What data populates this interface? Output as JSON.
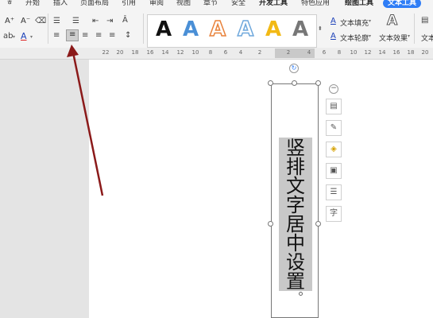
{
  "tabs": [
    {
      "label": "ㅎ"
    },
    {
      "label": "开始"
    },
    {
      "label": "插入"
    },
    {
      "label": "页面布局"
    },
    {
      "label": "引用"
    },
    {
      "label": "审阅"
    },
    {
      "label": "视图"
    },
    {
      "label": "章节"
    },
    {
      "label": "安全"
    },
    {
      "label": "开发工具"
    },
    {
      "label": "特色应用"
    },
    {
      "label": "绘图工具"
    },
    {
      "label": "文本工具"
    }
  ],
  "ribbon": {
    "wordart_sample": "A",
    "text_fill_label": "文本填充",
    "text_outline_label": "文本轮廓",
    "text_effect_label": "文本效果",
    "text_box_label": "文本",
    "font_grow": "A⁺",
    "font_shrink": "A⁻",
    "font_color": "A"
  },
  "ruler_ticks": [
    "22",
    "20",
    "18",
    "16",
    "14",
    "12",
    "10",
    "8",
    "6",
    "4",
    "2",
    "2",
    "4",
    "6",
    "8",
    "10",
    "12",
    "14",
    "16",
    "18",
    "20"
  ],
  "document": {
    "vertical_text": [
      "竖",
      "排",
      "文",
      "字",
      "居",
      "中",
      "设",
      "置"
    ]
  },
  "colors": {
    "accent": "#2f7df6",
    "arrow": "#8b1a1a"
  }
}
